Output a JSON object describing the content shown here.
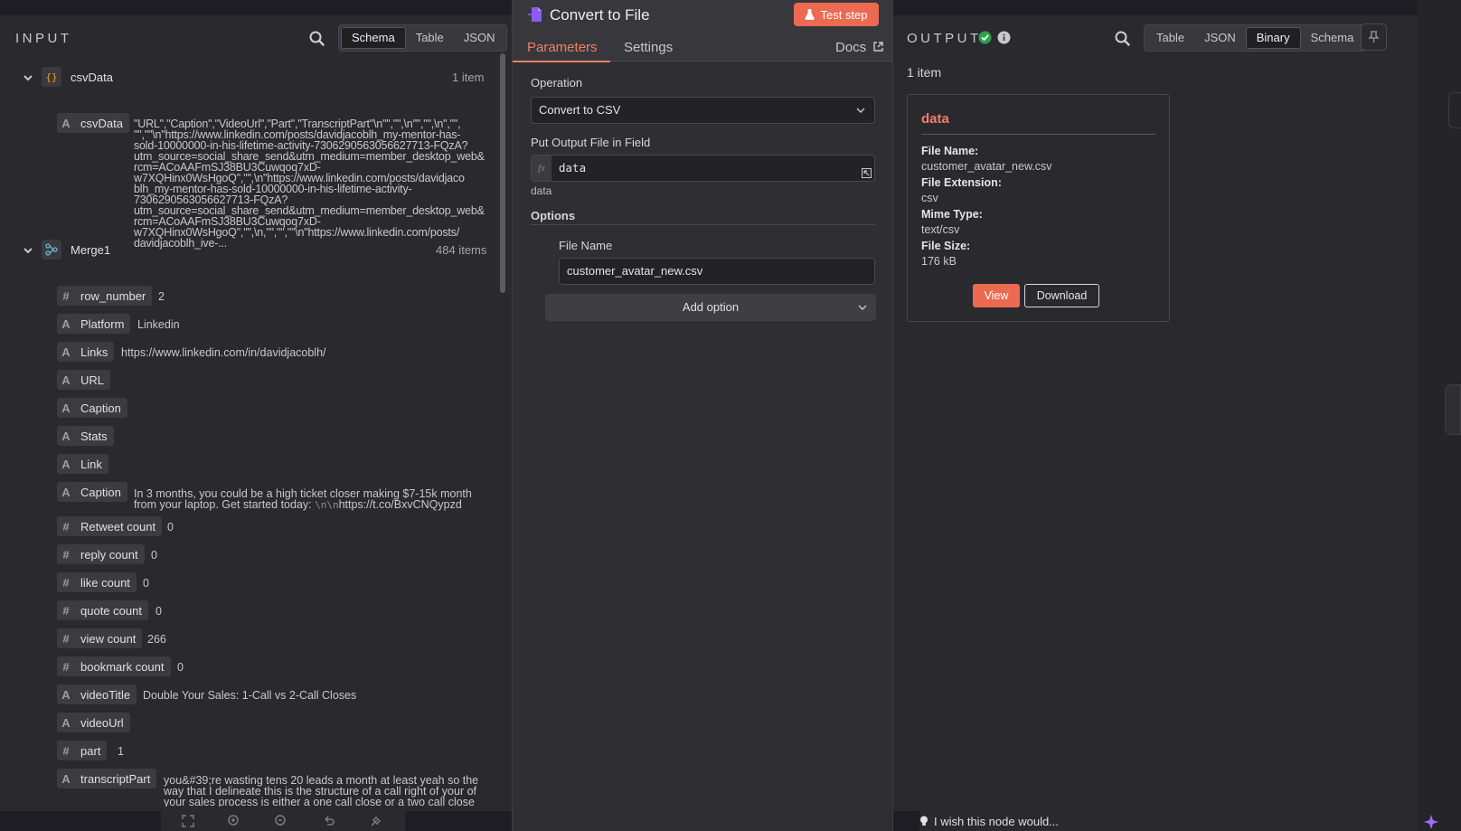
{
  "input": {
    "title": "INPUT",
    "tabs": [
      "Schema",
      "Table",
      "JSON"
    ],
    "active_tab": "Schema",
    "csv_node": {
      "label": "csvData",
      "count": "1 item",
      "field": "csvData",
      "value_lines": [
        "\"URL\",\"Caption\",\"VideoUrl\",\"Part\",\"TranscriptPart\"\\n\"\",\"\",\\n\"\",\"\",\\n\",\"\",",
        "\"\",\"\"\\n\"https://www.linkedin.com/posts/davidjacoblh_my-mentor-has-",
        "sold-10000000-in-his-lifetime-activity-7306290563056627713-FQzA?",
        "utm_source=social_share_send&utm_medium=member_desktop_web&",
        "rcm=ACoAAFmSJ38BU3Cuwqoq7xD-",
        "w7XQHinx0WsHgoQ\",\"\",\\n\"https://www.linkedin.com/posts/davidjaco",
        "blh_my-mentor-has-sold-10000000-in-his-lifetime-activity-",
        "7306290563056627713-FQzA?",
        "utm_source=social_share_send&utm_medium=member_desktop_web&",
        "rcm=ACoAAFmSJ38BU3Cuwqoq7xD-",
        "w7XQHinx0WsHgoQ\",\"\",\\n,\"\",\"\",\"\"\\n\"https://www.linkedin.com/posts/",
        "davidjacoblh_ive-..."
      ]
    },
    "merge_node": {
      "label": "Merge1",
      "count": "484 items",
      "fields": [
        {
          "type": "#",
          "name": "row_number",
          "value": "2"
        },
        {
          "type": "A",
          "name": "Platform",
          "value": "Linkedin"
        },
        {
          "type": "A",
          "name": "Links",
          "value": "https://www.linkedin.com/in/davidjacoblh/"
        },
        {
          "type": "A",
          "name": "URL",
          "value": ""
        },
        {
          "type": "A",
          "name": "Caption",
          "value": ""
        },
        {
          "type": "A",
          "name": "Stats",
          "value": ""
        },
        {
          "type": "A",
          "name": "Link",
          "value": ""
        },
        {
          "type": "A",
          "name": "Caption",
          "value_line1": "In 3 months, you could be a high ticket closer making $7-15k month",
          "value_line2a": "from your laptop. Get started today: ",
          "value_line2b": "\\n\\n",
          "value_line2c": "https://t.co/BxvCNQypzd"
        },
        {
          "type": "#",
          "name": "Retweet count",
          "value": "0"
        },
        {
          "type": "#",
          "name": "reply count",
          "value": "0"
        },
        {
          "type": "#",
          "name": "like count",
          "value": "0"
        },
        {
          "type": "#",
          "name": "quote count",
          "value": "0"
        },
        {
          "type": "#",
          "name": "view count",
          "value": "266"
        },
        {
          "type": "#",
          "name": "bookmark count",
          "value": "0"
        },
        {
          "type": "A",
          "name": "videoTitle",
          "value": "Double Your Sales: 1-Call vs 2-Call Closes"
        },
        {
          "type": "A",
          "name": "videoUrl",
          "value": ""
        },
        {
          "type": "#",
          "name": "part",
          "value": "1"
        },
        {
          "type": "A",
          "name": "transcriptPart",
          "value_line1": "you&#39;re wasting tens 20 leads a month at least yeah so the",
          "value_line2": "way that I delineate this is the structure of a call right of your of",
          "value_line3": "your sales process is either a one call close or a two call close"
        }
      ]
    }
  },
  "params": {
    "node_title": "Convert to File",
    "test_button": "Test step",
    "tabs": [
      "Parameters",
      "Settings"
    ],
    "docs_label": "Docs",
    "operation_label": "Operation",
    "operation_value": "Convert to CSV",
    "output_field_label": "Put Output File in Field",
    "output_field_value": "data",
    "output_field_hint": "data",
    "fx_label": "fx",
    "options_label": "Options",
    "file_name_label": "File Name",
    "file_name_value": "customer_avatar_new.csv",
    "add_option_label": "Add option"
  },
  "output": {
    "title": "OUTPUT",
    "tabs": [
      "Table",
      "JSON",
      "Binary",
      "Schema"
    ],
    "active_tab": "Binary",
    "count": "1 item",
    "binary": {
      "name": "data",
      "file_name_key": "File Name:",
      "file_name": "customer_avatar_new.csv",
      "extension_key": "File Extension:",
      "extension": "csv",
      "mime_key": "Mime Type:",
      "mime": "text/csv",
      "size_key": "File Size:",
      "size": "176 kB",
      "view_label": "View",
      "download_label": "Download"
    }
  },
  "feedback_text": "I wish this node would...",
  "colors": {
    "accent": "#ec6a52",
    "tab_active": "#f07f68",
    "success": "#2ba44f"
  }
}
